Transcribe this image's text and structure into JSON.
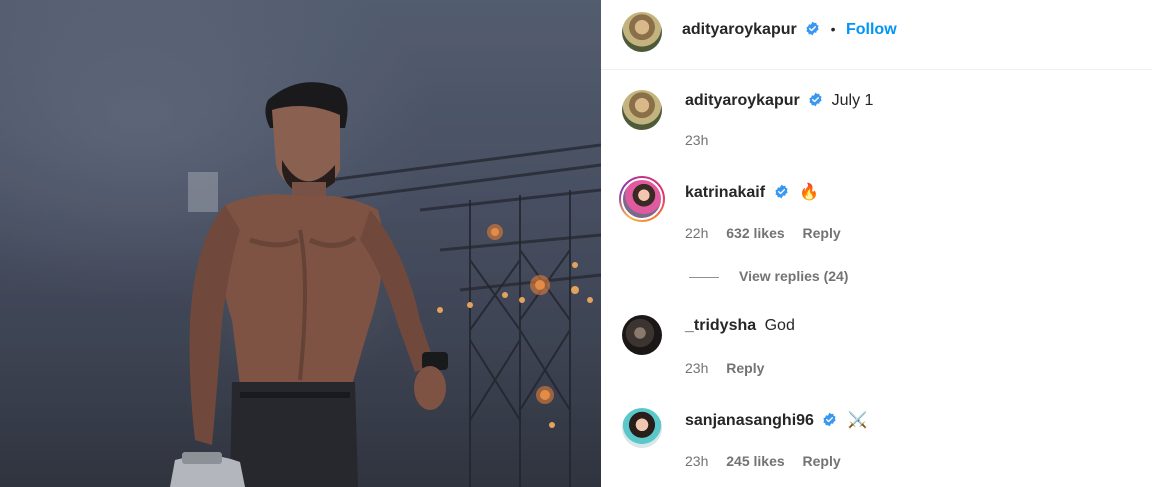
{
  "post": {
    "author": "adityaroykapur",
    "separator": "•",
    "follow_label": "Follow"
  },
  "comments": [
    {
      "username": "adityaroykapur",
      "verified": true,
      "text": "July 1",
      "time": "23h",
      "likes": "",
      "reply": ""
    },
    {
      "username": "katrinakaif",
      "verified": true,
      "text": "🔥",
      "time": "22h",
      "likes": "632 likes",
      "reply": "Reply"
    },
    {
      "username": "_tridysha",
      "verified": false,
      "text": "God",
      "time": "23h",
      "likes": "",
      "reply": "Reply"
    },
    {
      "username": "sanjanasanghi96",
      "verified": true,
      "text": "⚔️",
      "time": "23h",
      "likes": "245 likes",
      "reply": "Reply"
    }
  ],
  "view_replies": "View replies (24)",
  "colors": {
    "accent": "#0095f6",
    "verified": "#3897f0",
    "muted": "#737373",
    "text": "#262626"
  },
  "icons": [
    "verified-badge-icon",
    "fire-emoji",
    "crossed-swords-emoji"
  ]
}
